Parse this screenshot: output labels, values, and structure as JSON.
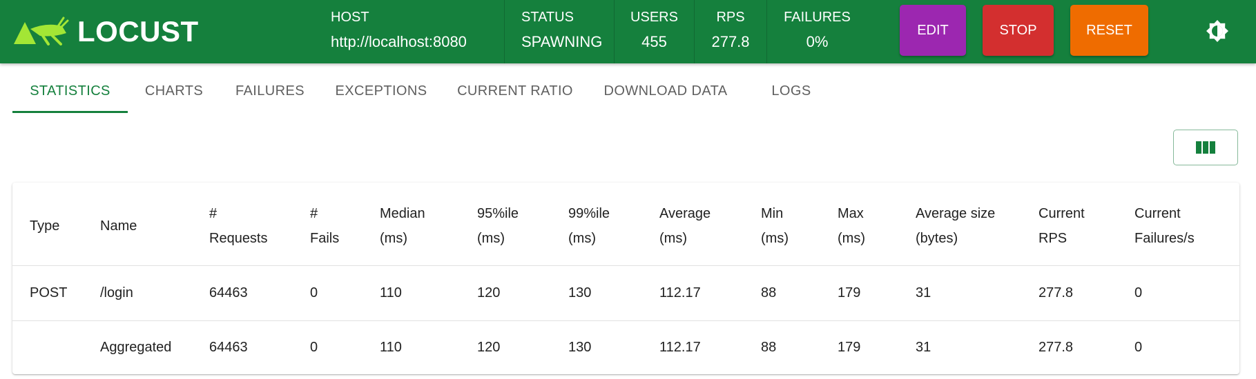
{
  "header": {
    "brand": "LOCUST",
    "stats": [
      {
        "label": "HOST",
        "value": "http://localhost:8080"
      },
      {
        "label": "STATUS",
        "value": "SPAWNING"
      },
      {
        "label": "USERS",
        "value": "455"
      },
      {
        "label": "RPS",
        "value": "277.8"
      },
      {
        "label": "FAILURES",
        "value": "0%"
      }
    ],
    "buttons": {
      "edit": "EDIT",
      "stop": "STOP",
      "reset": "RESET"
    },
    "theme_icon": "brightness-icon"
  },
  "colors": {
    "brand_green": "#15803d",
    "edit": "#9c27b0",
    "stop": "#d32f2f",
    "reset": "#ef6c00"
  },
  "tabs": [
    {
      "label": "STATISTICS",
      "active": true
    },
    {
      "label": "CHARTS"
    },
    {
      "label": "FAILURES"
    },
    {
      "label": "EXCEPTIONS"
    },
    {
      "label": "CURRENT RATIO"
    },
    {
      "label": "DOWNLOAD DATA"
    },
    {
      "label": "LOGS"
    }
  ],
  "column_toggle_icon": "view-column-icon",
  "table": {
    "columns": [
      [
        "Type"
      ],
      [
        "Name"
      ],
      [
        "#",
        "Requests"
      ],
      [
        "#",
        "Fails"
      ],
      [
        "Median",
        "(ms)"
      ],
      [
        "95%ile",
        "(ms)"
      ],
      [
        "99%ile",
        "(ms)"
      ],
      [
        "Average",
        "(ms)"
      ],
      [
        "Min",
        "(ms)"
      ],
      [
        "Max",
        "(ms)"
      ],
      [
        "Average size",
        "(bytes)"
      ],
      [
        "Current",
        "RPS"
      ],
      [
        "Current",
        "Failures/s"
      ]
    ],
    "rows": [
      [
        "POST",
        "/login",
        "64463",
        "0",
        "110",
        "120",
        "130",
        "112.17",
        "88",
        "179",
        "31",
        "277.8",
        "0"
      ],
      [
        "",
        "Aggregated",
        "64463",
        "0",
        "110",
        "120",
        "130",
        "112.17",
        "88",
        "179",
        "31",
        "277.8",
        "0"
      ]
    ]
  }
}
